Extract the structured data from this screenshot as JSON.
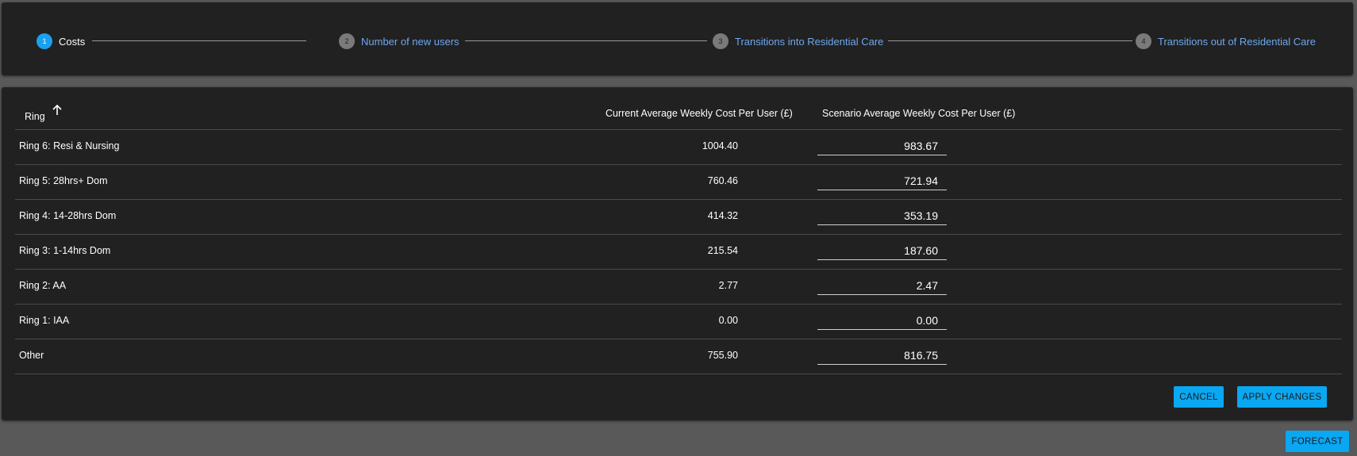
{
  "stepper": {
    "steps": [
      {
        "number": "1",
        "label": "Costs",
        "active": true
      },
      {
        "number": "2",
        "label": "Number of new users",
        "active": false
      },
      {
        "number": "3",
        "label": "Transitions into Residential Care",
        "active": false
      },
      {
        "number": "4",
        "label": "Transitions out of Residential Care",
        "active": false
      }
    ]
  },
  "table": {
    "headers": {
      "ring": "Ring",
      "current": "Current Average Weekly Cost Per User (£)",
      "scenario": "Scenario Average Weekly Cost Per User (£)"
    },
    "sort_icon": "arrow-up-icon",
    "rows": [
      {
        "ring": "Ring 6: Resi & Nursing",
        "current": "1004.40",
        "scenario": "983.67"
      },
      {
        "ring": "Ring 5: 28hrs+ Dom",
        "current": "760.46",
        "scenario": "721.94"
      },
      {
        "ring": "Ring 4: 14-28hrs Dom",
        "current": "414.32",
        "scenario": "353.19"
      },
      {
        "ring": "Ring 3: 1-14hrs Dom",
        "current": "215.54",
        "scenario": "187.60"
      },
      {
        "ring": "Ring 2: AA",
        "current": "2.77",
        "scenario": "2.47"
      },
      {
        "ring": "Ring 1: IAA",
        "current": "0.00",
        "scenario": "0.00"
      },
      {
        "ring": "Other",
        "current": "755.90",
        "scenario": "816.75"
      }
    ]
  },
  "actions": {
    "cancel": "CANCEL",
    "apply": "APPLY CHANGES",
    "forecast": "FORECAST"
  },
  "colors": {
    "accent": "#0aa7f2",
    "link": "#6ea7ef",
    "panel": "#212121",
    "background": "#595959"
  }
}
